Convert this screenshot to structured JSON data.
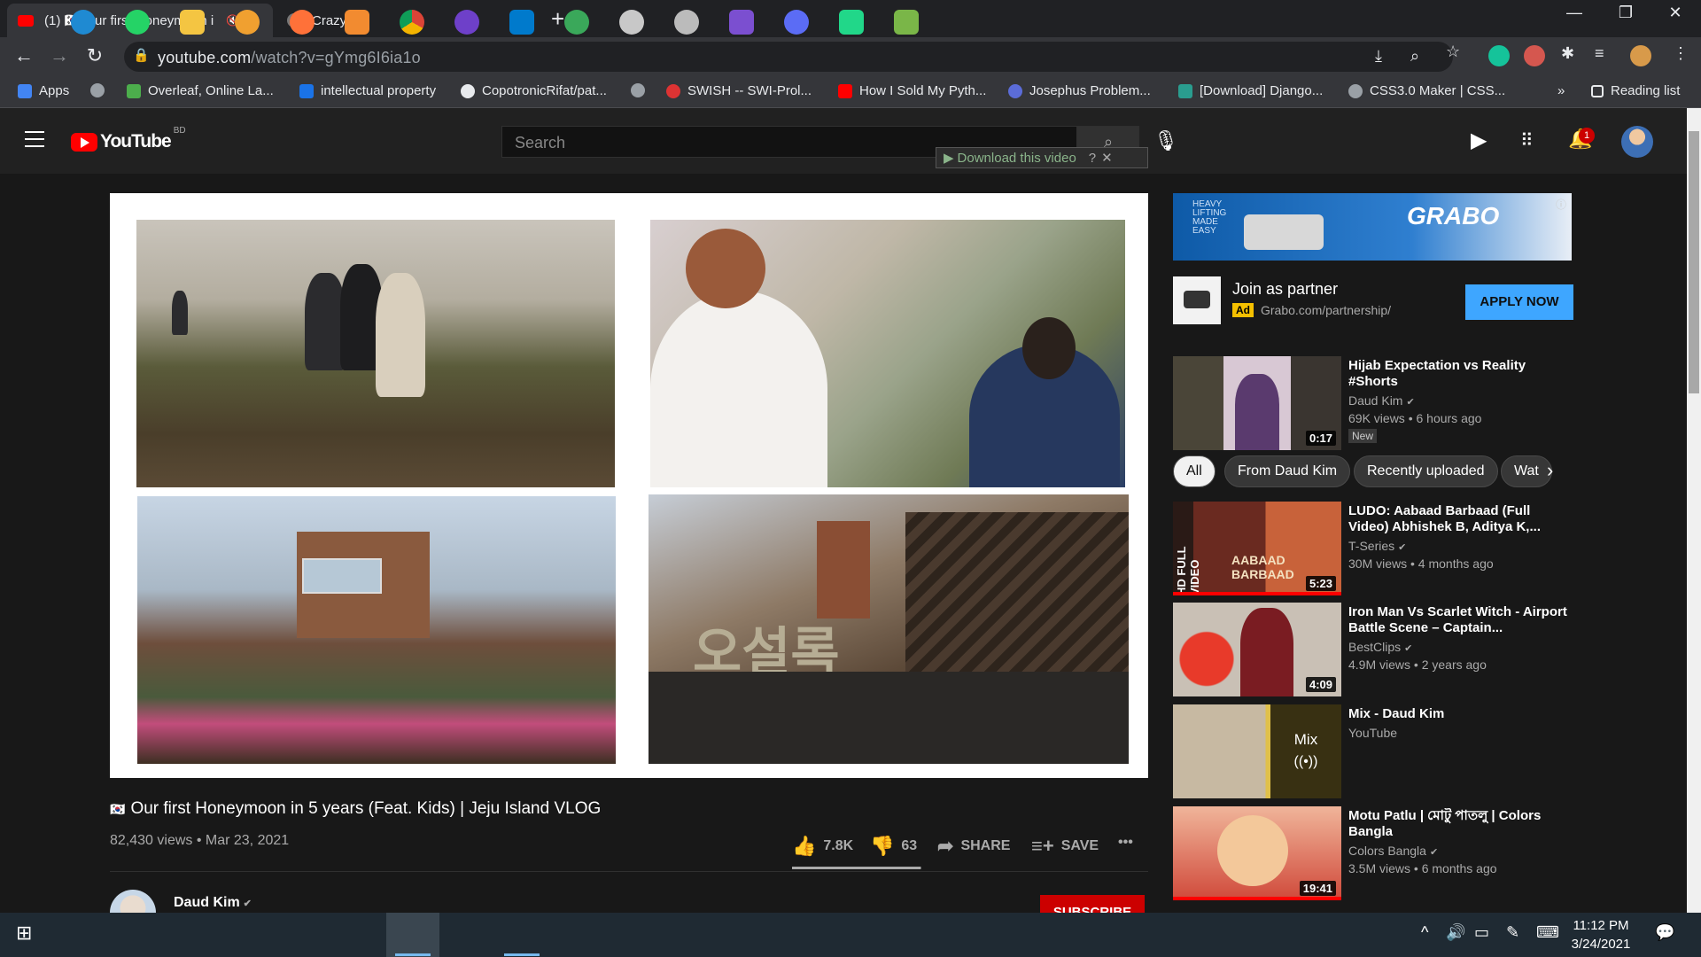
{
  "browser": {
    "tabs": [
      {
        "title": "(1) 🇰🇷 Our first Honeymoon i",
        "active": true
      },
      {
        "title": "CrazyHD",
        "active": false
      }
    ],
    "url_host": "youtube.com",
    "url_path": "/watch?v=gYmg6I6ia1o",
    "bookmarks": [
      {
        "label": "Apps",
        "color": "#4285f4"
      },
      {
        "label": "",
        "color": "#9aa0a6"
      },
      {
        "label": "Overleaf, Online La...",
        "color": "#4cae4c"
      },
      {
        "label": "intellectual property",
        "color": "#1a73e8"
      },
      {
        "label": "CopotronicRifat/pat...",
        "color": "#e8eaed"
      },
      {
        "label": "",
        "color": "#9aa0a6"
      },
      {
        "label": "SWISH -- SWI-Prol...",
        "color": "#d33"
      },
      {
        "label": "How I Sold My Pyth...",
        "color": "#f00"
      },
      {
        "label": "Josephus Problem...",
        "color": "#5b6cd8"
      },
      {
        "label": "[Download] Django...",
        "color": "#2a9d8f"
      },
      {
        "label": "CSS3.0 Maker | CSS...",
        "color": "#9aa0a6"
      }
    ],
    "bookmarks_more": "»",
    "reading_list": "Reading list"
  },
  "youtube": {
    "logo_text": "YouTube",
    "country": "BD",
    "search_placeholder": "Search",
    "download_bar": "Download this video",
    "notification_count": "1"
  },
  "video": {
    "title_flag": "🇰🇷",
    "title": "Our first Honeymoon in 5 years (Feat. Kids) | Jeju Island VLOG",
    "meta": "82,430 views • Mar 23, 2021",
    "likes": "7.8K",
    "dislikes": "63",
    "like_ratio": 0.99,
    "share_label": "SHARE",
    "save_label": "SAVE",
    "channel": "Daud Kim",
    "subscribe_label": "SUBSCRIBE"
  },
  "ad": {
    "brand": "GRABO",
    "tagline": "HEAVY LIFTING MADE EASY",
    "title": "Join as partner",
    "badge": "Ad",
    "url": "Grabo.com/partnership/",
    "cta": "APPLY NOW"
  },
  "chips": [
    "All",
    "From Daud Kim",
    "Recently uploaded",
    "Wat"
  ],
  "recommendations": [
    {
      "title": "Hijab Expectation vs Reality #Shorts",
      "channel": "Daud Kim",
      "verified": true,
      "views": "69K views • 6 hours ago",
      "duration": "0:17",
      "badge": "New",
      "colors": [
        "#4a4538",
        "#7a5a6e"
      ]
    },
    {
      "title": "LUDO: Aabaad Barbaad (Full Video) Abhishek B, Aditya K,...",
      "channel": "T-Series",
      "verified": true,
      "views": "30M views • 4 months ago",
      "duration": "5:23",
      "colors": [
        "#6a2a20",
        "#c8623a"
      ]
    },
    {
      "title": "Iron Man Vs Scarlet Witch - Airport Battle Scene – Captain...",
      "channel": "BestClips",
      "verified": true,
      "views": "4.9M views • 2 years ago",
      "duration": "4:09",
      "colors": [
        "#c9c0b5",
        "#8a1c22"
      ]
    },
    {
      "title": "Mix - Daud Kim",
      "channel": "YouTube",
      "verified": false,
      "views": "",
      "duration": "",
      "mix_label": "Mix",
      "colors": [
        "#c7b9a2",
        "#e0c04a"
      ]
    },
    {
      "title": "Motu Patlu | মোটু পাতলু | Colors Bangla",
      "channel": "Colors Bangla",
      "verified": true,
      "views": "3.5M views • 6 months ago",
      "duration": "19:41",
      "colors": [
        "#d0493a",
        "#f0b59a"
      ]
    }
  ],
  "taskbar": {
    "time": "11:12 PM",
    "date": "3/24/2021"
  }
}
